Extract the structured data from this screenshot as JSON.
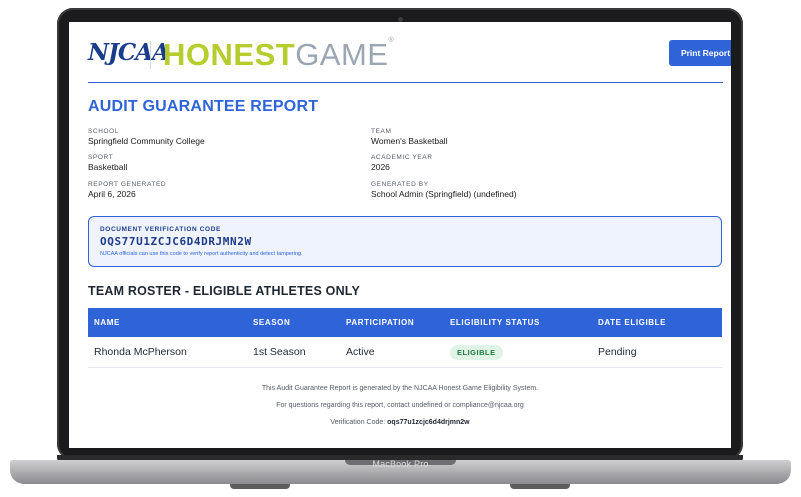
{
  "device": {
    "label": "MacBook Pro"
  },
  "header": {
    "njcaa_logo": "NJCAA",
    "honest_word": "HONEST",
    "game_word": "GAME",
    "registered_mark": "®",
    "print_label": "Print Report"
  },
  "report": {
    "title": "AUDIT GUARANTEE REPORT",
    "fields": [
      {
        "label": "SCHOOL",
        "value": "Springfield Community College"
      },
      {
        "label": "TEAM",
        "value": "Women's Basketball"
      },
      {
        "label": "SPORT",
        "value": "Basketball"
      },
      {
        "label": "ACADEMIC YEAR",
        "value": "2026"
      },
      {
        "label": "REPORT GENERATED",
        "value": "April 6, 2026"
      },
      {
        "label": "GENERATED BY",
        "value": "School Admin (Springfield) (undefined)"
      }
    ]
  },
  "verification": {
    "label": "DOCUMENT VERIFICATION CODE",
    "code": "OQS77U1ZCJC6D4DRJMN2W",
    "note": "NJCAA officials can use this code to verify report authenticity and detect tampering."
  },
  "roster": {
    "title": "TEAM ROSTER - ELIGIBLE ATHLETES ONLY",
    "columns": [
      "NAME",
      "SEASON",
      "PARTICIPATION",
      "ELIGIBILITY STATUS",
      "DATE ELIGIBLE"
    ],
    "rows": [
      {
        "name": "Rhonda McPherson",
        "season": "1st Season",
        "participation": "Active",
        "status": "ELIGIBLE",
        "date": "Pending"
      }
    ]
  },
  "footer": {
    "line1": "This Audit Guarantee Report is generated by the NJCAA Honest Game Eligibility System.",
    "line2": "For questions regarding this report, contact undefined or compliance@njcaa.org",
    "verify_prefix": "Verification Code: ",
    "verify_code": "oqs77u1zcjc6d4drjmn2w"
  },
  "colors": {
    "accent": "#2f64d8",
    "honest_green": "#b7cc2d",
    "eligible_bg": "#dff3e6",
    "eligible_text": "#1e7a3e"
  }
}
